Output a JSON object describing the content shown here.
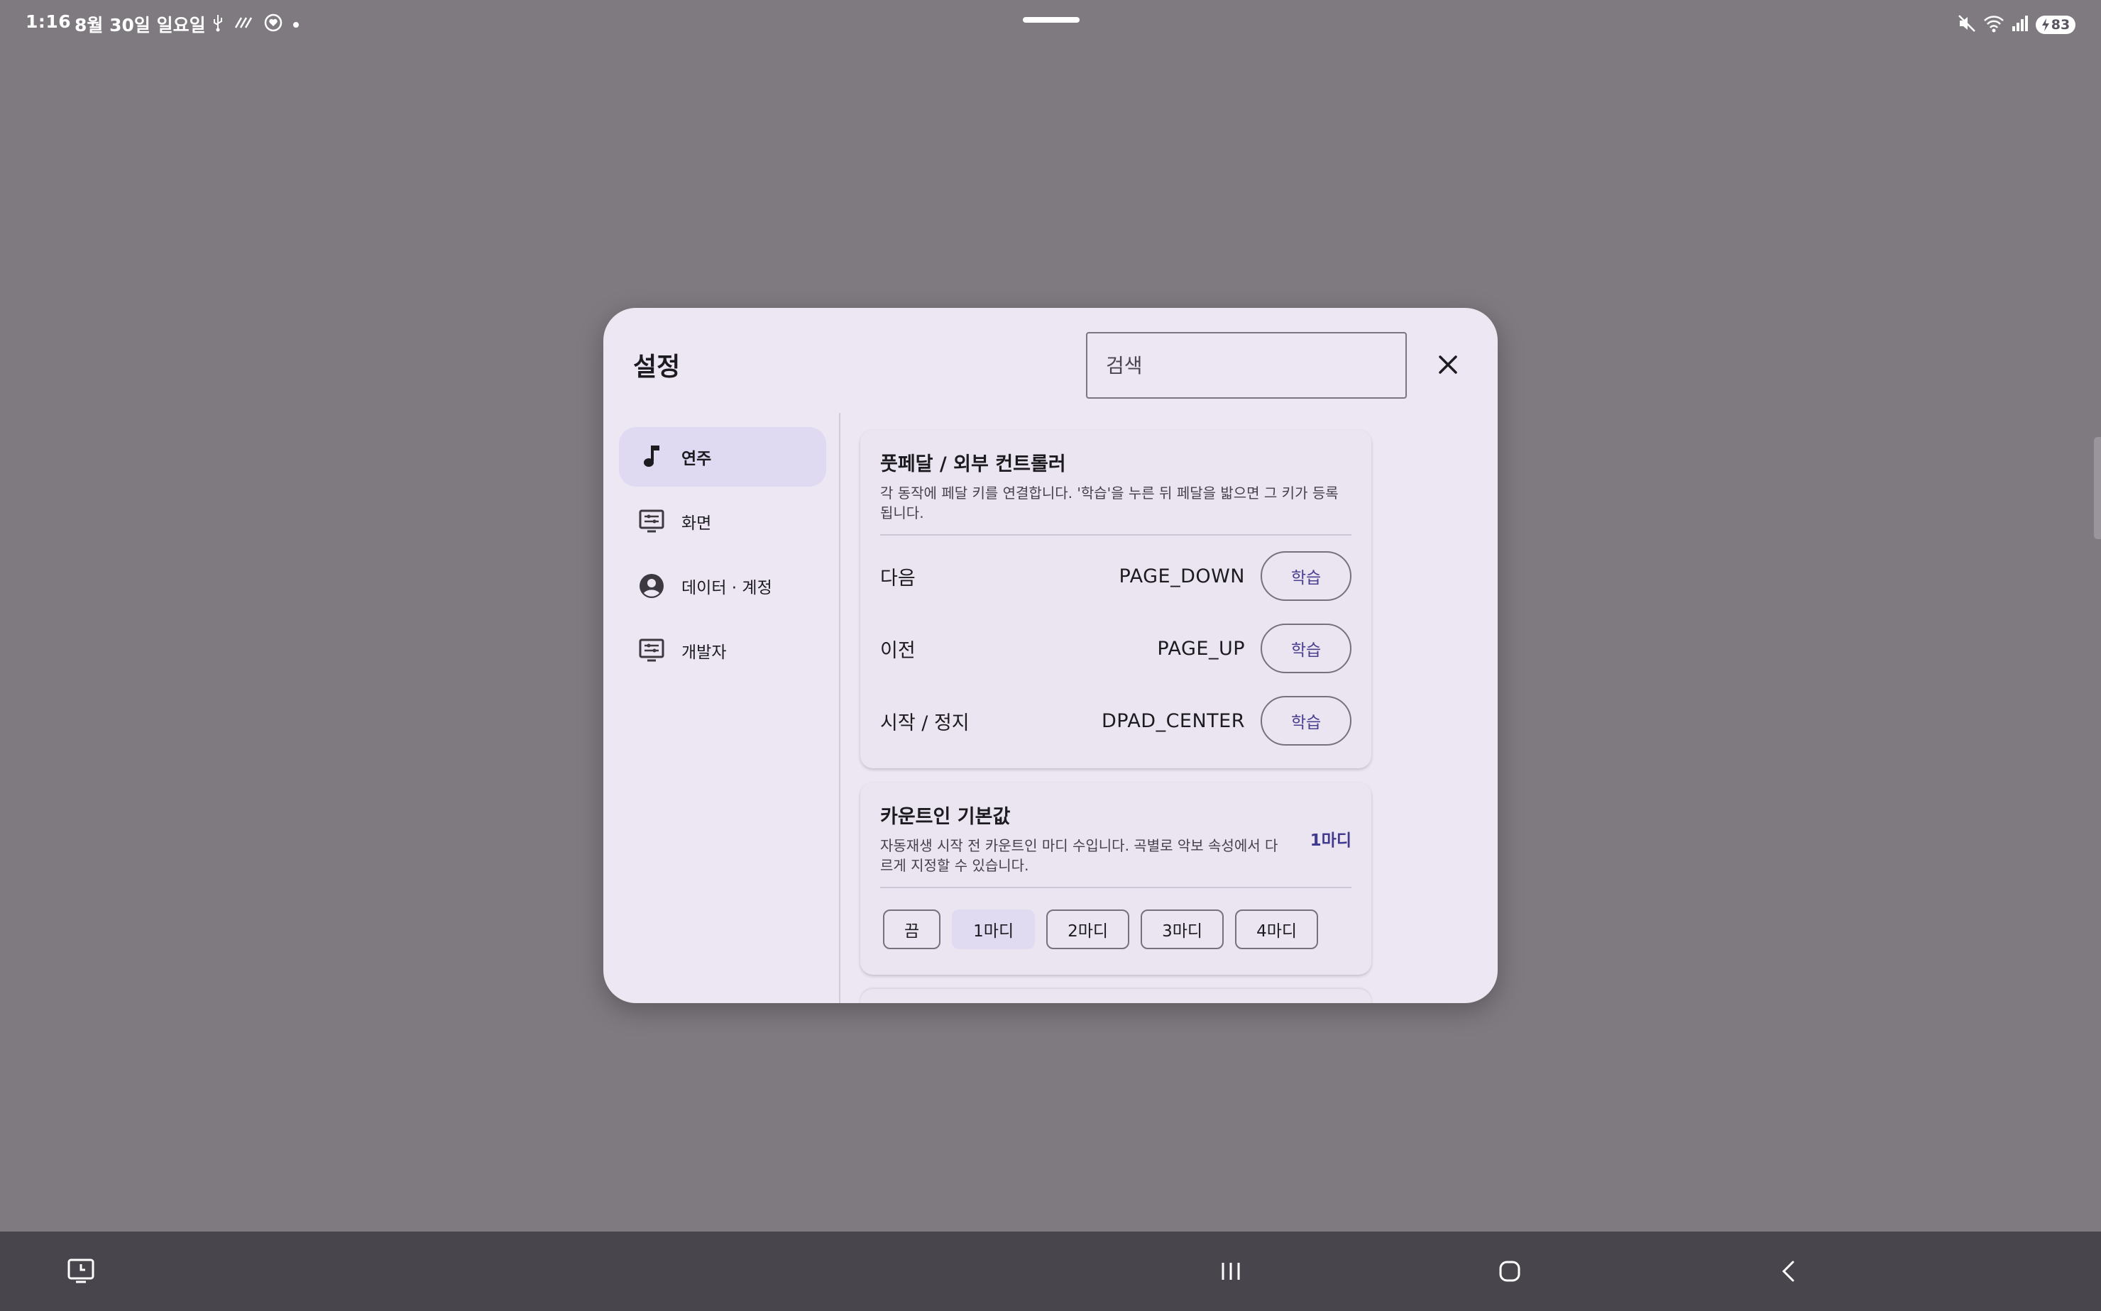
{
  "status_bar": {
    "time": "1:16",
    "date": "8월 30일 일요일",
    "battery": "83",
    "left_icons": [
      "usb-icon",
      "wave-icon",
      "heart-monitor-icon",
      "dot-icon"
    ],
    "right_icons": [
      "mute-icon",
      "wifi-icon",
      "signal-icon",
      "battery-charging-icon"
    ]
  },
  "dialog": {
    "title": "설정",
    "search_placeholder": "검색",
    "close_icon": "close-icon"
  },
  "sidebar": {
    "items": [
      {
        "label": "연주",
        "icon": "music-note-icon",
        "active": true
      },
      {
        "label": "화면",
        "icon": "display-settings-icon",
        "active": false
      },
      {
        "label": "데이터 · 계정",
        "icon": "account-circle-icon",
        "active": false
      },
      {
        "label": "개발자",
        "icon": "developer-settings-icon",
        "active": false
      }
    ]
  },
  "pedal_card": {
    "title": "풋페달 / 외부 컨트롤러",
    "description": "각 동작에 페달 키를 연결합니다. '학습'을 누른 뒤 페달을 밟으면 그 키가 등록됩니다.",
    "rows": [
      {
        "label": "다음",
        "key": "PAGE_DOWN",
        "button": "학습"
      },
      {
        "label": "이전",
        "key": "PAGE_UP",
        "button": "학습"
      },
      {
        "label": "시작 / 정지",
        "key": "DPAD_CENTER",
        "button": "학습"
      }
    ]
  },
  "countin_card": {
    "title": "카운트인 기본값",
    "description": "자동재생 시작 전 카운트인 마디 수입니다. 곡별로 악보 속성에서 다르게 지정할 수 있습니다.",
    "value": "1마디",
    "options": [
      {
        "label": "끔",
        "selected": false
      },
      {
        "label": "1마디",
        "selected": true
      },
      {
        "label": "2마디",
        "selected": false
      },
      {
        "label": "3마디",
        "selected": false
      },
      {
        "label": "4마디",
        "selected": false
      }
    ]
  },
  "nav_bar": {
    "icons": [
      "screenshot-toolbar-icon",
      "recent-apps-icon",
      "home-icon",
      "back-icon"
    ]
  },
  "colors": {
    "scrim": "#7f7a80",
    "dialog_bg": "#ede7f4",
    "accent": "#3f3a8e",
    "active_nav": "#dfdaf2"
  }
}
